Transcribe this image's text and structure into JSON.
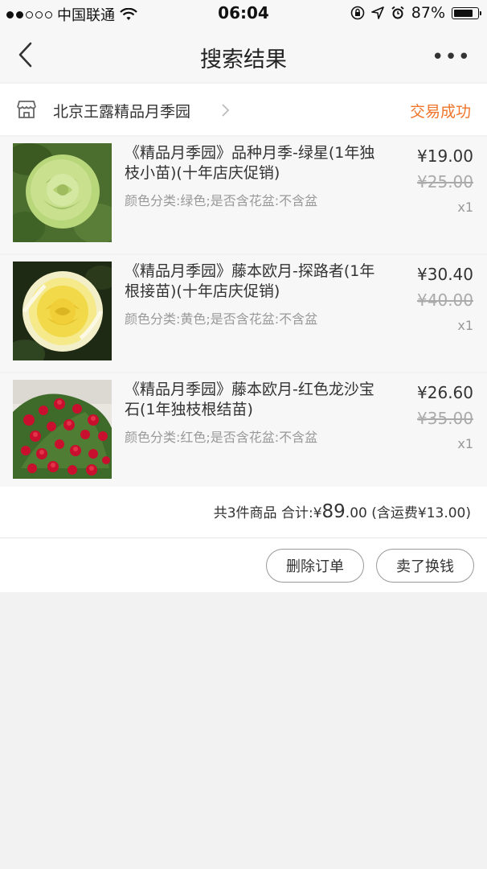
{
  "status_bar": {
    "carrier": "中国联通",
    "time": "06:04",
    "battery": "87%",
    "battery_level": 0.87,
    "icons": [
      "signal-dots",
      "wifi-icon",
      "rotation-lock-icon",
      "location-icon",
      "alarm-icon",
      "battery-icon"
    ]
  },
  "nav": {
    "title": "搜索结果",
    "more": "•••"
  },
  "shop": {
    "name": "北京王露精品月季园",
    "status": "交易成功",
    "status_color": "#f0742a"
  },
  "items": [
    {
      "title": "《精品月季园》品种月季-绿星(1年独枝小苗)(十年店庆促销)",
      "spec": "颜色分类:绿色;是否含花盆:不含盆",
      "price": "¥19.00",
      "orig_price": "¥25.00",
      "qty": "x1",
      "image": "green-rose"
    },
    {
      "title": "《精品月季园》藤本欧月-探路者(1年根接苗)(十年店庆促销)",
      "spec": "颜色分类:黄色;是否含花盆:不含盆",
      "price": "¥30.40",
      "orig_price": "¥40.00",
      "qty": "x1",
      "image": "yellow-rose"
    },
    {
      "title": "《精品月季园》藤本欧月-红色龙沙宝石(1年独枝根结苗)",
      "spec": "颜色分类:红色;是否含花盆:不含盆",
      "price": "¥26.60",
      "orig_price": "¥35.00",
      "qty": "x1",
      "image": "red-climbing-roses"
    }
  ],
  "summary": {
    "count_text": "共3件商品 合计:",
    "currency": "¥",
    "total_int": "89",
    "total_dec": ".00",
    "shipping_text": "(含运费¥13.00)"
  },
  "actions": {
    "delete_label": "删除订单",
    "sell_label": "卖了换钱"
  }
}
